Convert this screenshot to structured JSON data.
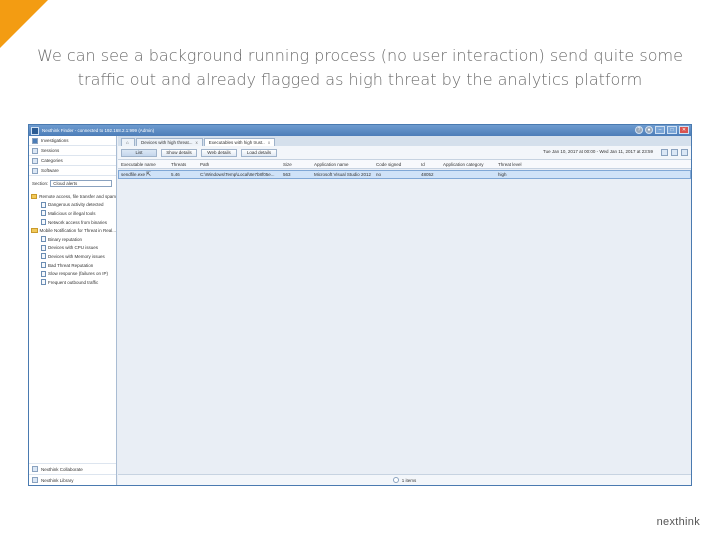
{
  "caption": "We can see a background running process (no user interaction) send quite some traffic out and already flagged as high threat by the analytics platform",
  "logo_text": "nexthink",
  "colors": {
    "accent_corner": "#f39c12",
    "titlebar": "#4c7db8",
    "selected_row": "#cfe2f8"
  },
  "window": {
    "title": "Nexthink Finder - connected to 192.168.2.1:999 (Admin)",
    "controls": [
      "?",
      "●",
      "–",
      "□",
      "✕"
    ]
  },
  "sidebar": {
    "items": [
      {
        "label": "Investigations",
        "icon": "investigations-icon"
      },
      {
        "label": "Sessions",
        "icon": "sessions-icon"
      },
      {
        "label": "Categories",
        "icon": "categories-icon"
      },
      {
        "label": "Software",
        "icon": "software-icon"
      }
    ],
    "section_label": "Section:",
    "section_value": "Cloud alerts",
    "tree": [
      {
        "type": "folder",
        "label": "Remote access, file transfer and spam"
      },
      {
        "type": "leaf",
        "label": "Dangerous activity detected"
      },
      {
        "type": "leaf",
        "label": "Malicious or illegal tools"
      },
      {
        "type": "leaf",
        "label": "Network access from binaries"
      },
      {
        "type": "folder",
        "label": "Mobile Notification for Threat in Real..."
      },
      {
        "type": "leaf",
        "label": "Binary reputation"
      },
      {
        "type": "leaf",
        "label": "Devices with CPU issues"
      },
      {
        "type": "leaf",
        "label": "Devices with Memory issues"
      },
      {
        "type": "leaf",
        "label": "Bad Threat Reputation"
      },
      {
        "type": "leaf",
        "label": "Slow response (failures on IP)"
      },
      {
        "type": "leaf",
        "label": "Frequent outbound traffic"
      }
    ],
    "bottom": [
      {
        "label": "Nexthink Collaborate"
      },
      {
        "label": "Nexthink Library"
      }
    ]
  },
  "tabs": [
    {
      "label": "",
      "kind": "home"
    },
    {
      "label": "Devices with high threat...",
      "close": "x"
    },
    {
      "label": "Executables with high trust..",
      "close": "x"
    }
  ],
  "toolbar": {
    "buttons": [
      "List",
      "Show details",
      "Web details",
      "Load details"
    ],
    "timeframe": "Tue Jan 10, 2017 at 00:00 - Wed Jan 11, 2017 at 23:59",
    "icons": [
      "refresh-icon",
      "export-icon",
      "settings-icon"
    ]
  },
  "grid": {
    "headers": [
      "Executable name",
      "Threats",
      "Path",
      "Size",
      "Application name",
      "Code signed",
      "Id",
      "Application category",
      "Threat level"
    ],
    "rows": [
      [
        "sendfile.exe",
        "5.46",
        "C:\\Windows\\Temp\\Local\\8e7b8f05e...",
        "563",
        "Microsoft Visual Studio 2012",
        "no",
        "48052",
        "",
        "high"
      ]
    ]
  },
  "status": {
    "label": "1 items"
  }
}
